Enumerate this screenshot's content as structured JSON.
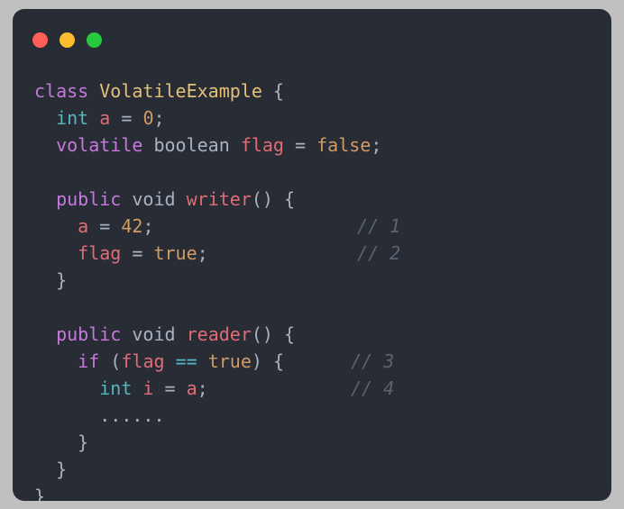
{
  "window": {
    "background_color": "#282c34",
    "page_background_color": "#c0c0c0",
    "controls": [
      {
        "name": "close",
        "color": "#ff5f56"
      },
      {
        "name": "minimize",
        "color": "#ffbd2e"
      },
      {
        "name": "maximize",
        "color": "#27c93f"
      }
    ]
  },
  "code": {
    "language": "java",
    "full_text": "class VolatileExample {\n  int a = 0;\n  volatile boolean flag = false;\n\n  public void writer() {\n    a = 42;            // 1\n    flag = true;       // 2\n  }\n\n  public void reader() {\n    if (flag == true) {  // 3\n      int i = a;         // 4\n      ......\n    }\n  }\n}",
    "lines": [
      {
        "id": "line-1",
        "tokens": [
          {
            "text": "class ",
            "type": "keyword"
          },
          {
            "text": "VolatileExample",
            "type": "class"
          },
          {
            "text": " {",
            "type": "punct"
          }
        ]
      },
      {
        "id": "line-2",
        "tokens": [
          {
            "text": "  ",
            "type": "plain"
          },
          {
            "text": "int",
            "type": "type"
          },
          {
            "text": " ",
            "type": "plain"
          },
          {
            "text": "a",
            "type": "var"
          },
          {
            "text": " = ",
            "type": "punct"
          },
          {
            "text": "0",
            "type": "number"
          },
          {
            "text": ";",
            "type": "punct"
          }
        ]
      },
      {
        "id": "line-3",
        "tokens": [
          {
            "text": "  ",
            "type": "plain"
          },
          {
            "text": "volatile",
            "type": "keyword"
          },
          {
            "text": " ",
            "type": "plain"
          },
          {
            "text": "boolean",
            "type": "builtin"
          },
          {
            "text": " ",
            "type": "plain"
          },
          {
            "text": "flag",
            "type": "var"
          },
          {
            "text": " = ",
            "type": "punct"
          },
          {
            "text": "false",
            "type": "const"
          },
          {
            "text": ";",
            "type": "punct"
          }
        ]
      },
      {
        "id": "line-4",
        "tokens": []
      },
      {
        "id": "line-5",
        "tokens": [
          {
            "text": "  ",
            "type": "plain"
          },
          {
            "text": "public",
            "type": "keyword"
          },
          {
            "text": " ",
            "type": "plain"
          },
          {
            "text": "void",
            "type": "builtin"
          },
          {
            "text": " ",
            "type": "plain"
          },
          {
            "text": "writer",
            "type": "func"
          },
          {
            "text": "() {",
            "type": "punct"
          }
        ]
      },
      {
        "id": "line-6",
        "tokens": [
          {
            "text": "    ",
            "type": "plain"
          },
          {
            "text": "a",
            "type": "var"
          },
          {
            "text": " = ",
            "type": "punct"
          },
          {
            "text": "42",
            "type": "number"
          },
          {
            "text": ";",
            "type": "punct"
          }
        ],
        "comment": "// 1",
        "comment_col": "a"
      },
      {
        "id": "line-7",
        "tokens": [
          {
            "text": "    ",
            "type": "plain"
          },
          {
            "text": "flag",
            "type": "var"
          },
          {
            "text": " = ",
            "type": "punct"
          },
          {
            "text": "true",
            "type": "const"
          },
          {
            "text": ";",
            "type": "punct"
          }
        ],
        "comment": "// 2",
        "comment_col": "a"
      },
      {
        "id": "line-8",
        "tokens": [
          {
            "text": "  }",
            "type": "punct"
          }
        ]
      },
      {
        "id": "line-9",
        "tokens": []
      },
      {
        "id": "line-10",
        "tokens": [
          {
            "text": "  ",
            "type": "plain"
          },
          {
            "text": "public",
            "type": "keyword"
          },
          {
            "text": " ",
            "type": "plain"
          },
          {
            "text": "void",
            "type": "builtin"
          },
          {
            "text": " ",
            "type": "plain"
          },
          {
            "text": "reader",
            "type": "func"
          },
          {
            "text": "() {",
            "type": "punct"
          }
        ]
      },
      {
        "id": "line-11",
        "tokens": [
          {
            "text": "    ",
            "type": "plain"
          },
          {
            "text": "if",
            "type": "keyword"
          },
          {
            "text": " (",
            "type": "punct"
          },
          {
            "text": "flag",
            "type": "var"
          },
          {
            "text": " ",
            "type": "plain"
          },
          {
            "text": "==",
            "type": "operator"
          },
          {
            "text": " ",
            "type": "plain"
          },
          {
            "text": "true",
            "type": "const"
          },
          {
            "text": ") {",
            "type": "punct"
          }
        ],
        "comment": "// 3",
        "comment_col": "b"
      },
      {
        "id": "line-12",
        "tokens": [
          {
            "text": "      ",
            "type": "plain"
          },
          {
            "text": "int",
            "type": "type"
          },
          {
            "text": " ",
            "type": "plain"
          },
          {
            "text": "i",
            "type": "var"
          },
          {
            "text": " = ",
            "type": "punct"
          },
          {
            "text": "a",
            "type": "var"
          },
          {
            "text": ";",
            "type": "punct"
          }
        ],
        "comment": "// 4",
        "comment_col": "b"
      },
      {
        "id": "line-13",
        "tokens": [
          {
            "text": "      ",
            "type": "plain"
          },
          {
            "text": "......",
            "type": "dots"
          }
        ]
      },
      {
        "id": "line-14",
        "tokens": [
          {
            "text": "    }",
            "type": "punct"
          }
        ]
      },
      {
        "id": "line-15",
        "tokens": [
          {
            "text": "  }",
            "type": "punct"
          }
        ]
      },
      {
        "id": "line-16",
        "tokens": [
          {
            "text": "}",
            "type": "punct"
          }
        ]
      }
    ]
  }
}
